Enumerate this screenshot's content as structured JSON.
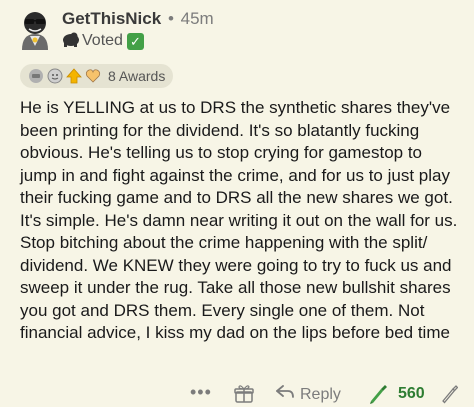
{
  "comment": {
    "username": "GetThisNick",
    "separator": "•",
    "timestamp": "45m",
    "flair_text": "Voted",
    "flair_icons": [
      "gorilla-icon",
      "check-icon"
    ],
    "awards_label": "8 Awards",
    "award_icons": [
      "helpful-award-icon",
      "wholesome-award-icon",
      "gold-award-icon",
      "silver-award-icon"
    ],
    "body": "He is YELLING at us to DRS the synthetic shares they've been printing for the dividend. It's so blatantly fucking obvious. He's telling us to stop crying for gamestop to jump in and fight against the crime, and for us to just play their fucking game and to DRS all the new shares we got. It's simple. He's damn near writing it out on the wall for us. Stop bitching about the crime happening with the split/ dividend. We KNEW they were going to try to fuck us and sweep it under the rug. Take all those new bullshit shares you got and DRS them. Every single one of them. Not financial advice, I kiss my dad on the lips before bed time"
  },
  "actions": {
    "more_label": "•••",
    "reply_label": "Reply",
    "score": "560",
    "score_color": "#2e7d32"
  },
  "colors": {
    "background": "#f7f5e6",
    "award_pill": "#e5e3d2",
    "upvote_active": "#43a047"
  }
}
